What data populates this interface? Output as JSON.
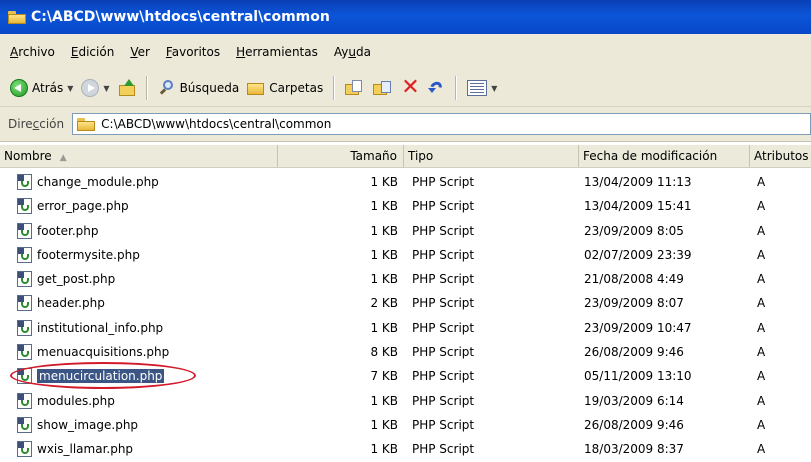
{
  "window": {
    "title": "C:\\ABCD\\www\\htdocs\\central\\common"
  },
  "menu": [
    {
      "label": "Archivo",
      "underline": "A",
      "rest": "rchivo"
    },
    {
      "label": "Edición",
      "underline": "E",
      "rest": "dición"
    },
    {
      "label": "Ver",
      "underline": "V",
      "rest": "er"
    },
    {
      "label": "Favoritos",
      "underline": "F",
      "rest": "avoritos"
    },
    {
      "label": "Herramientas",
      "underline": "H",
      "rest": "erramientas"
    },
    {
      "label": "Ayuda",
      "underline": "u",
      "pre": "Ay",
      "rest": "da"
    }
  ],
  "toolbar": {
    "back_label": "Atrás",
    "search_label": "Búsqueda",
    "folders_label": "Carpetas"
  },
  "address": {
    "label_pre": "Dire",
    "label_u": "c",
    "label_post": "ción",
    "path": "C:\\ABCD\\www\\htdocs\\central\\common"
  },
  "columns": {
    "name": "Nombre",
    "size": "Tamaño",
    "type": "Tipo",
    "modified": "Fecha de modificación",
    "attributes": "Atributos"
  },
  "files": [
    {
      "name": "change_module.php",
      "size": "1 KB",
      "type": "PHP Script",
      "modified": "13/04/2009 11:13",
      "attr": "A"
    },
    {
      "name": "error_page.php",
      "size": "1 KB",
      "type": "PHP Script",
      "modified": "13/04/2009 15:41",
      "attr": "A"
    },
    {
      "name": "footer.php",
      "size": "1 KB",
      "type": "PHP Script",
      "modified": "23/09/2009 8:05",
      "attr": "A"
    },
    {
      "name": "footermysite.php",
      "size": "1 KB",
      "type": "PHP Script",
      "modified": "02/07/2009 23:39",
      "attr": "A"
    },
    {
      "name": "get_post.php",
      "size": "1 KB",
      "type": "PHP Script",
      "modified": "21/08/2008 4:49",
      "attr": "A"
    },
    {
      "name": "header.php",
      "size": "2 KB",
      "type": "PHP Script",
      "modified": "23/09/2009 8:07",
      "attr": "A"
    },
    {
      "name": "institutional_info.php",
      "size": "1 KB",
      "type": "PHP Script",
      "modified": "23/09/2009 10:47",
      "attr": "A"
    },
    {
      "name": "menuacquisitions.php",
      "size": "8 KB",
      "type": "PHP Script",
      "modified": "26/08/2009 9:46",
      "attr": "A"
    },
    {
      "name": "menucirculation.php",
      "size": "7 KB",
      "type": "PHP Script",
      "modified": "05/11/2009 13:10",
      "attr": "A",
      "selected": true
    },
    {
      "name": "modules.php",
      "size": "1 KB",
      "type": "PHP Script",
      "modified": "19/03/2009 6:14",
      "attr": "A"
    },
    {
      "name": "show_image.php",
      "size": "1 KB",
      "type": "PHP Script",
      "modified": "26/08/2009 9:46",
      "attr": "A"
    },
    {
      "name": "wxis_llamar.php",
      "size": "1 KB",
      "type": "PHP Script",
      "modified": "18/03/2009 8:37",
      "attr": "A"
    }
  ],
  "colors": {
    "titlebar": "#0c55d8",
    "selection": "#3b5584",
    "annotation_ring": "#d11a2a",
    "chrome": "#ece9d8"
  }
}
